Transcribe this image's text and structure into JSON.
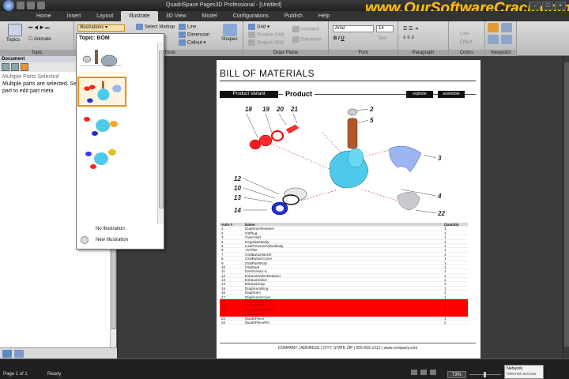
{
  "window": {
    "title": "QuadriSpace Pages3D Professional - [Untitled]",
    "watermark": "www.OurSoftwareCrack.com"
  },
  "tabs": [
    "Home",
    "Insert",
    "Layout",
    "Illustrate",
    "3D View",
    "Model",
    "Configurations",
    "Publish",
    "Help"
  ],
  "active_tab": "Illustrate",
  "ribbon": {
    "topics_label": "Topics",
    "animate_label": "Animate",
    "illustrations_select": "Illustrations",
    "select_markup": "Select Markup",
    "line": "Line",
    "dimension": "Dimension",
    "callout": "Callout",
    "shapes": "Shapes",
    "grid": "Grid",
    "position_grid": "Position Grid",
    "snap_to_grid": "Snap to Grid",
    "increase": "Increase",
    "decrease": "Decrease",
    "font_name": "Arial",
    "font_size": "14",
    "text_label": "Text",
    "right_line": "Line",
    "effect": "Effect",
    "groups": {
      "topic": "Topic",
      "illustration_tools": "Illustration Tools",
      "draw_plane": "Draw Plane",
      "font": "Font",
      "paragraph": "Paragraph",
      "colors": "Colors",
      "viewpoint": "Viewpoint"
    }
  },
  "left_panel": {
    "title": "Document",
    "hidden_line": "Multiple Parts Selected",
    "text": "Multiple parts are selected. Select a single part to edit part meta"
  },
  "dropdown": {
    "title": "Topic: BOM",
    "option1": "No Illustration",
    "option2": "New Illustration"
  },
  "page": {
    "title": "BILL OF MATERIALS",
    "variant_label": "Product Variant",
    "product_label": "Product",
    "explode": "explode",
    "assemble": "assemble",
    "callouts": [
      "18",
      "19",
      "20",
      "21",
      "2",
      "5",
      "3",
      "12",
      "10",
      "13",
      "14",
      "4",
      "22"
    ],
    "table_header": {
      "no": "Auto #",
      "name": "Name",
      "qty": "Quantity"
    },
    "rows": [
      {
        "no": "1",
        "name": "DiaphramRetainer",
        "qty": "1"
      },
      {
        "no": "2",
        "name": "O2Plug",
        "qty": "1"
      },
      {
        "no": "3",
        "name": "Overmold",
        "qty": "1"
      },
      {
        "no": "4",
        "name": "RegulatorBody",
        "qty": "1"
      },
      {
        "no": "5",
        "name": "LowPressureValveBody",
        "qty": "1"
      },
      {
        "no": "6",
        "name": "AirFilter",
        "qty": "1"
      },
      {
        "no": "7",
        "name": "OralButtonBezel",
        "qty": "1"
      },
      {
        "no": "8",
        "name": "OralButtonCover",
        "qty": "1"
      },
      {
        "no": "9",
        "name": "OralPushRod",
        "qty": "1"
      },
      {
        "no": "10",
        "name": "OralSeal",
        "qty": "1"
      },
      {
        "no": "11",
        "name": "PanScrew1-4",
        "qty": "1"
      },
      {
        "no": "12",
        "name": "ExhaustValveRetainer",
        "qty": "1"
      },
      {
        "no": "13",
        "name": "ExhaustValve",
        "qty": "1"
      },
      {
        "no": "14",
        "name": "ExhaustCap",
        "qty": "1"
      },
      {
        "no": "15",
        "name": "DiaphramRing",
        "qty": "1"
      },
      {
        "no": "16",
        "name": "Diaphram",
        "qty": "1"
      },
      {
        "no": "17",
        "name": "DiaphramCover",
        "qty": "1"
      },
      {
        "no": "18",
        "name": "PurgeButtonCover",
        "qty": "1"
      },
      {
        "no": "19",
        "name": "PurgeButton",
        "qty": "1"
      },
      {
        "no": "20",
        "name": "PurgeButtonBezel",
        "qty": "1"
      },
      {
        "no": "21",
        "name": "Valvespring",
        "qty": "1"
      },
      {
        "no": "22",
        "name": "MouthPiece",
        "qty": "1"
      },
      {
        "no": "23",
        "name": "MouthPiecePin",
        "qty": "2"
      }
    ],
    "highlighted_rows": [
      18,
      19,
      20,
      21
    ],
    "footer": "COMPANY  |  ADDRESS  |  CITY, STATE ZIP  |  555-555-1212  |  www.company.com"
  },
  "status": {
    "page": "Page 1 of 1",
    "ready": "Ready",
    "zoom": "73%",
    "tray_line1": "Network",
    "tray_line2": "Internet access"
  },
  "colors": {
    "highlight": "#ff0000",
    "accent": "#f08a00",
    "part_blue": "#3fc6e8"
  }
}
